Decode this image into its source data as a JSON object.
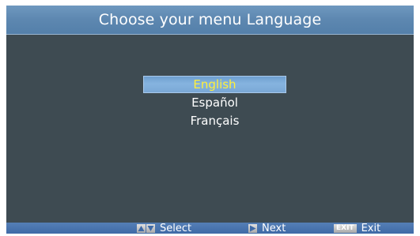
{
  "title": "Choose your menu Language",
  "languages": [
    {
      "label": "English",
      "selected": true
    },
    {
      "label": "Español",
      "selected": false
    },
    {
      "label": "Français",
      "selected": false
    }
  ],
  "footer": {
    "select_label": "Select",
    "next_label": "Next",
    "exit_key": "EXIT",
    "exit_label": "Exit"
  },
  "colors": {
    "background": "#3e4b52",
    "title_bar": "#5d87b0",
    "highlight": "#7aa8d6",
    "selected_text": "#ffef3a",
    "footer": "#4a74ae"
  }
}
